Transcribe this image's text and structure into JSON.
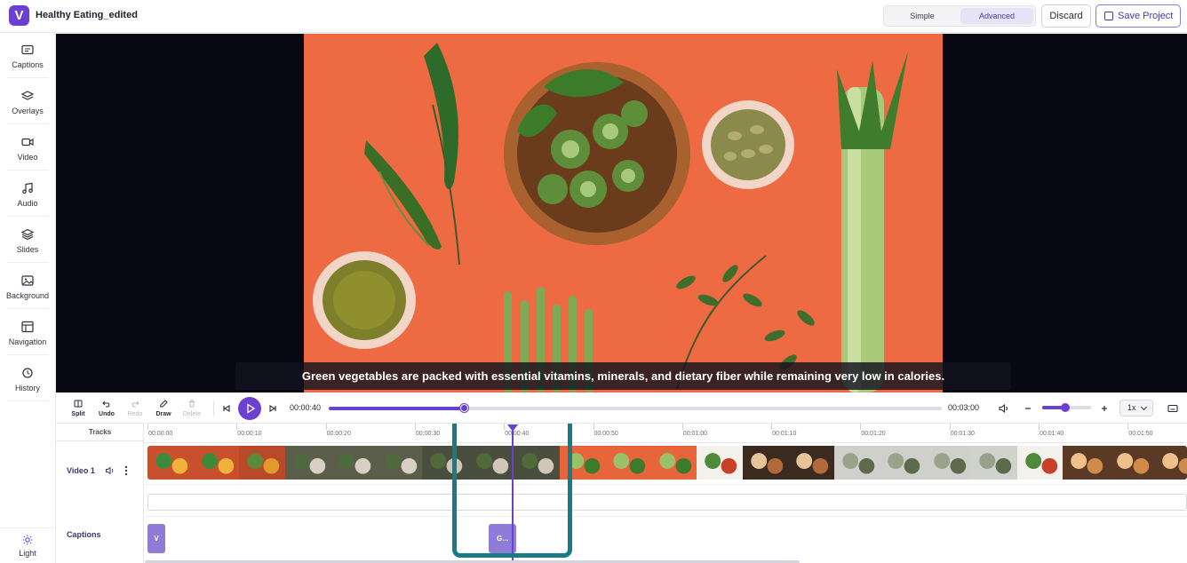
{
  "app": {
    "logo_letter": "V",
    "project_title": "Healthy Eating_edited"
  },
  "header": {
    "modes": [
      "Simple",
      "Advanced"
    ],
    "active_mode": "Advanced",
    "discard_label": "Discard",
    "save_label": "Save Project"
  },
  "sidebar": {
    "items": [
      {
        "label": "Captions",
        "icon": "captions-icon"
      },
      {
        "label": "Overlays",
        "icon": "layers-icon"
      },
      {
        "label": "Video",
        "icon": "video-camera-icon"
      },
      {
        "label": "Audio",
        "icon": "music-note-icon"
      },
      {
        "label": "Slides",
        "icon": "slides-stack-icon"
      },
      {
        "label": "Background",
        "icon": "image-icon"
      },
      {
        "label": "Navigation",
        "icon": "layout-icon"
      },
      {
        "label": "History",
        "icon": "clock-history-icon"
      }
    ],
    "theme_label": "Light",
    "theme_icon": "sun-icon"
  },
  "preview": {
    "subtitle": "Green vegetables are packed with essential vitamins, minerals, and dietary fiber while remaining very low in calories.",
    "background_color": "#ee6a43"
  },
  "controls": {
    "tools": [
      {
        "label": "Split",
        "icon": "split-icon",
        "enabled": true
      },
      {
        "label": "Undo",
        "icon": "undo-icon",
        "enabled": true
      },
      {
        "label": "Redo",
        "icon": "redo-icon",
        "enabled": false
      },
      {
        "label": "Draw",
        "icon": "pencil-icon",
        "enabled": true
      },
      {
        "label": "Delete",
        "icon": "trash-icon",
        "enabled": false
      }
    ],
    "current_time": "00:00:40",
    "total_time": "00:03:00",
    "progress_fraction": 0.2222,
    "zoom_fraction": 0.48,
    "speed": "1x"
  },
  "timeline": {
    "tracks_header": "Tracks",
    "ruler_labels": [
      "00:00:00",
      "00:00:10",
      "00:00:20",
      "00:00:30",
      "00:00:40",
      "00:00:50",
      "00:01:00",
      "00:01:10",
      "00:01:20",
      "00:01:30",
      "00:01:40",
      "00:01:50"
    ],
    "video_track_label": "Video 1",
    "captions_track_label": "Captions",
    "caption_blocks": [
      "V",
      "G..."
    ]
  },
  "colors": {
    "accent": "#6c3fd3",
    "caption_block": "#8f7cd6",
    "highlight": "#1a7b85",
    "preview_bg": "#080812"
  }
}
